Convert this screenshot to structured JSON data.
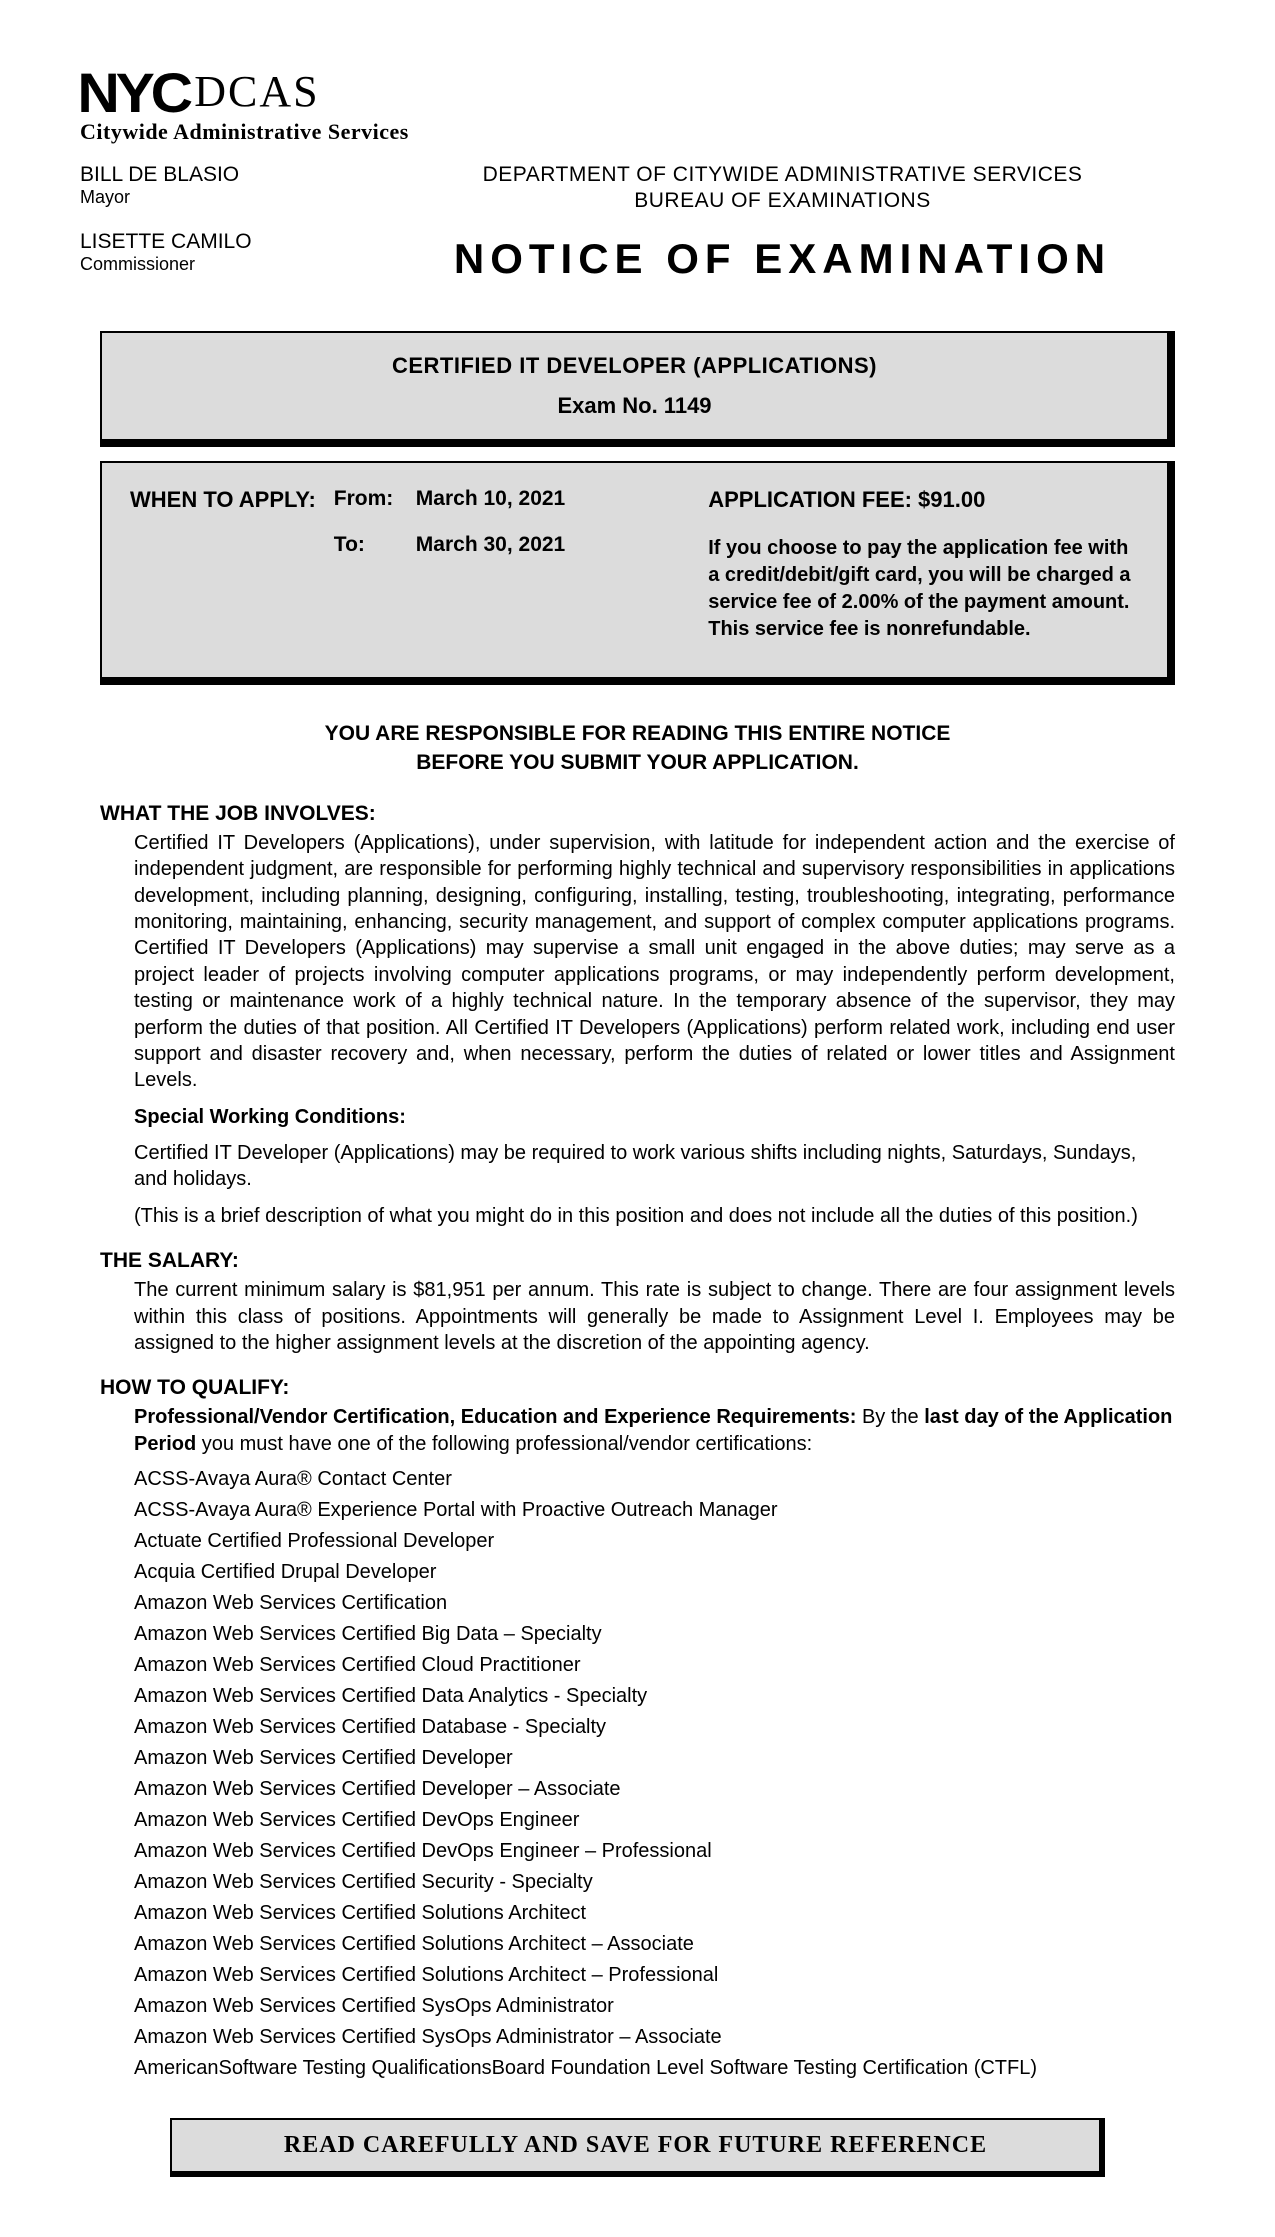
{
  "logo": {
    "nyc": "NYC",
    "dcas": "DCAS",
    "sub": "Citywide Administrative Services"
  },
  "officials": {
    "mayor_name": "BILL DE BLASIO",
    "mayor_title": "Mayor",
    "commissioner_name": "LISETTE CAMILO",
    "commissioner_title": "Commissioner"
  },
  "header": {
    "dept": "DEPARTMENT OF CITYWIDE ADMINISTRATIVE SERVICES",
    "bureau": "BUREAU OF EXAMINATIONS",
    "notice": "NOTICE OF EXAMINATION"
  },
  "panel1": {
    "exam_title": "CERTIFIED IT DEVELOPER (APPLICATIONS)",
    "exam_no": "Exam No. 1149"
  },
  "panel2": {
    "when_label": "WHEN TO APPLY:",
    "from_label": "From:",
    "from_date": "March 10, 2021",
    "to_label": "To:",
    "to_date": "March 30, 2021",
    "fee_label": "APPLICATION FEE: $91.00",
    "fee_note": "If you choose to pay the application fee with a credit/debit/gift card, you will be charged a service fee of 2.00% of the payment amount. This service fee is nonrefundable."
  },
  "responsible": {
    "line1": "YOU ARE RESPONSIBLE FOR READING THIS ENTIRE NOTICE",
    "line2": "BEFORE YOU SUBMIT YOUR APPLICATION."
  },
  "job": {
    "heading": "WHAT THE JOB INVOLVES:",
    "para1": "Certified IT Developers (Applications), under supervision, with latitude for independent action and the exercise of independent judgment, are responsible for performing highly technical and supervisory responsibilities in applications development, including planning, designing, configuring, installing, testing, troubleshooting, integrating, performance monitoring, maintaining, enhancing, security management, and support of complex computer applications programs. Certified IT Developers (Applications) may supervise a small unit engaged in the above duties; may serve as a project leader of projects involving computer applications programs, or may independently perform development, testing or maintenance work of a highly technical nature. In the temporary absence of the supervisor, they may perform the duties of that position. All Certified IT Developers (Applications) perform related work, including end user support and disaster recovery and, when necessary, perform the duties of related or lower titles and Assignment Levels.",
    "swc_head": "Special Working Conditions:",
    "swc_body": "Certified IT Developer (Applications) may be required to work various shifts including nights, Saturdays, Sundays, and holidays.",
    "brief": "(This is a brief description of what you might do in this position and does not include all the duties of this position.)"
  },
  "salary": {
    "heading": "THE SALARY:",
    "body": "The current minimum salary is $81,951 per annum. This rate is subject to change. There are four assignment levels within this class of positions. Appointments will generally be made to Assignment Level I. Employees may be assigned to the higher assignment levels at the discretion of the appointing agency."
  },
  "qualify": {
    "heading": "HOW TO QUALIFY:",
    "intro_bold1": "Professional/Vendor Certification, Education and Experience Requirements:",
    "intro_mid": " By the ",
    "intro_bold2": "last day of the Application Period",
    "intro_tail": " you must have one of the following professional/vendor certifications:",
    "certs": [
      "ACSS-Avaya Aura® Contact Center",
      "ACSS-Avaya Aura® Experience Portal with Proactive Outreach Manager",
      "Actuate Certified Professional Developer",
      "Acquia Certified Drupal Developer",
      "Amazon Web Services Certification",
      "Amazon Web Services Certified Big Data – Specialty",
      "Amazon Web Services Certified Cloud Practitioner",
      "Amazon Web Services Certified Data Analytics - Specialty",
      "Amazon Web Services Certified Database - Specialty",
      "Amazon Web Services Certified Developer",
      "Amazon Web Services Certified Developer – Associate",
      "Amazon Web Services Certified DevOps Engineer",
      "Amazon Web Services Certified DevOps Engineer – Professional",
      "Amazon Web Services Certified Security - Specialty",
      "Amazon Web Services Certified Solutions Architect",
      "Amazon Web Services Certified Solutions Architect – Associate",
      "Amazon Web Services Certified Solutions Architect – Professional",
      "Amazon Web Services Certified SysOps Administrator",
      "Amazon Web Services Certified SysOps Administrator – Associate",
      "AmericanSoftware Testing QualificationsBoard Foundation Level Software Testing Certification (CTFL)"
    ]
  },
  "footer": "READ CAREFULLY AND SAVE FOR FUTURE REFERENCE"
}
